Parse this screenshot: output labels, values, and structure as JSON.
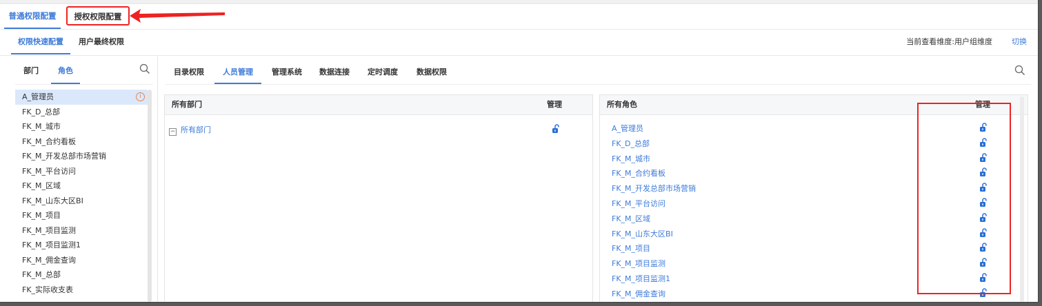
{
  "main_tabs": [
    "普通权限配置",
    "授权权限配置"
  ],
  "sub_tabs": [
    "权限快速配置",
    "用户最终权限"
  ],
  "dimension_info": "当前查看维度:用户组维度",
  "switch_label": "切换",
  "left_tabs": [
    "部门",
    "角色"
  ],
  "roles": [
    "A_管理员",
    "FK_D_总部",
    "FK_M_城市",
    "FK_M_合约看板",
    "FK_M_开发总部市场营销",
    "FK_M_平台访问",
    "FK_M_区域",
    "FK_M_山东大区BI",
    "FK_M_项目",
    "FK_M_项目监测",
    "FK_M_项目监测1",
    "FK_M_佣金查询",
    "FK_M_总部",
    "FK_实际收支表"
  ],
  "right_tabs": [
    "目录权限",
    "人员管理",
    "管理系统",
    "数据连接",
    "定时调度",
    "数据权限"
  ],
  "active_right_tab": "人员管理",
  "dept_panel": {
    "header_name": "所有部门",
    "header_manage": "管理",
    "root_label": "所有部门"
  },
  "role_panel": {
    "header_name": "所有角色",
    "header_manage": "管理",
    "rows": [
      "A_管理员",
      "FK_D_总部",
      "FK_M_城市",
      "FK_M_合约看板",
      "FK_M_开发总部市场营销",
      "FK_M_平台访问",
      "FK_M_区域",
      "FK_M_山东大区BI",
      "FK_M_项目",
      "FK_M_项目监测",
      "FK_M_项目监测1",
      "FK_M_佣金查询"
    ]
  },
  "colors": {
    "accent": "#3d7bd9",
    "annotation_red": "#ee2222"
  },
  "icons": {
    "search": "search-icon",
    "lock": "unlock-icon",
    "info": "info-icon"
  }
}
